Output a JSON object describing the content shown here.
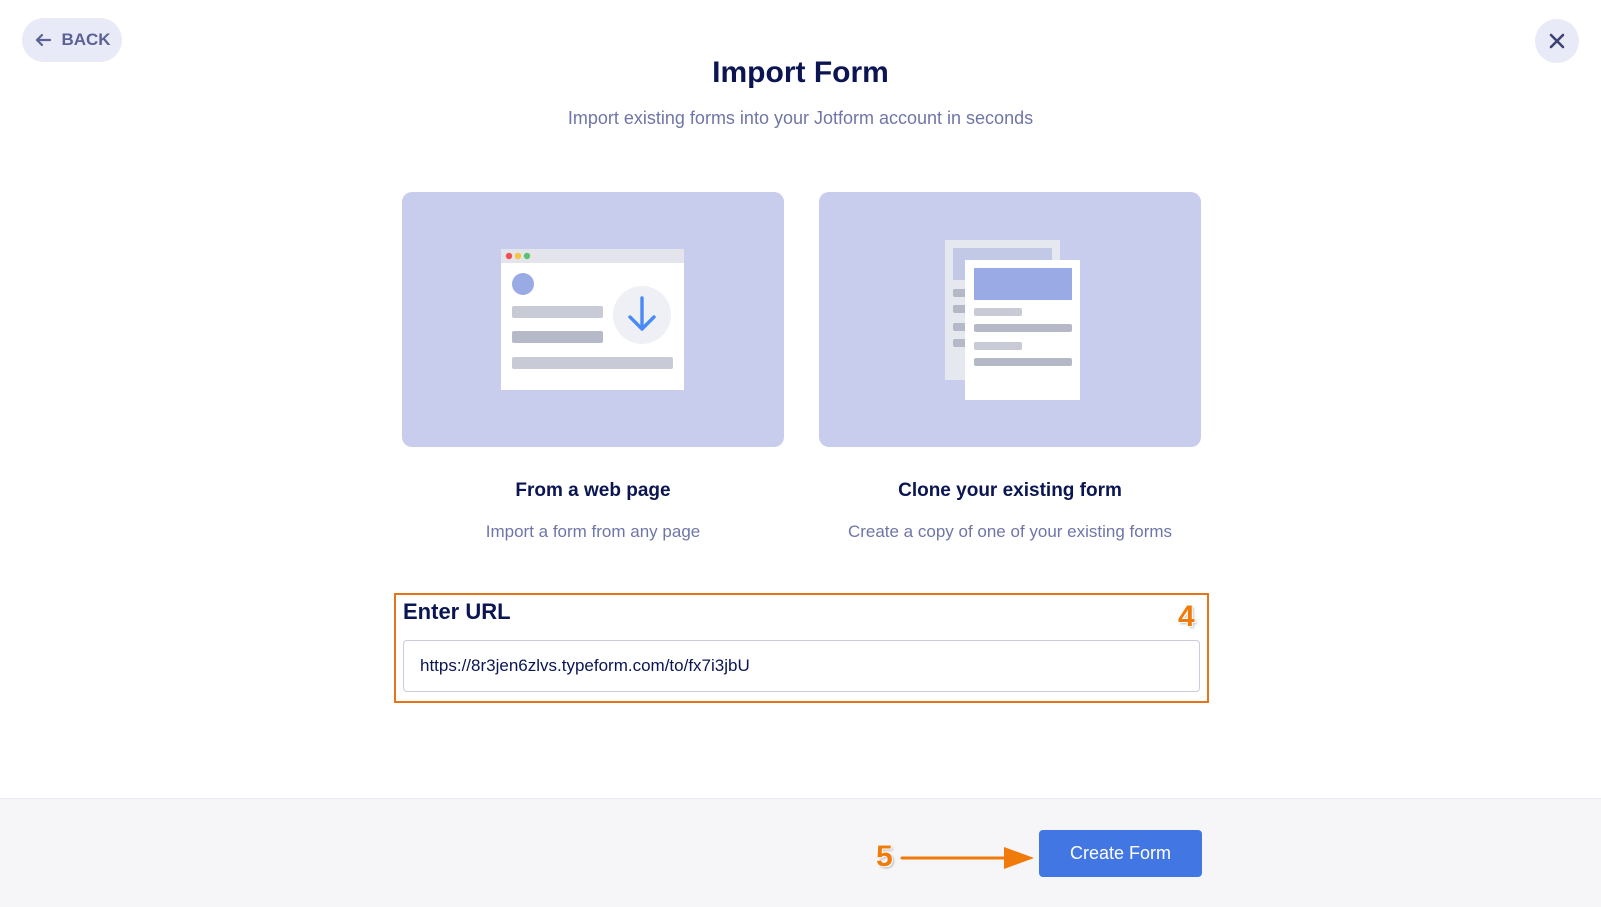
{
  "header": {
    "back_label": "BACK",
    "title": "Import Form",
    "subtitle": "Import existing forms into your Jotform account in seconds"
  },
  "options": [
    {
      "title": "From a web page",
      "description": "Import a form from any page",
      "icon": "web-page-download-illustration"
    },
    {
      "title": "Clone your existing form",
      "description": "Create a copy of one of your existing forms",
      "icon": "clone-form-illustration"
    }
  ],
  "url_field": {
    "label": "Enter URL",
    "value": "https://8r3jen6zlvs.typeform.com/to/fx7i3jbU"
  },
  "annotations": {
    "step_url": "4",
    "step_create": "5"
  },
  "footer": {
    "create_label": "Create Form"
  },
  "colors": {
    "accent": "#4277e3",
    "annotation": "#f07a0a",
    "illustration_bg": "#c8cdee",
    "title": "#0a1551"
  }
}
